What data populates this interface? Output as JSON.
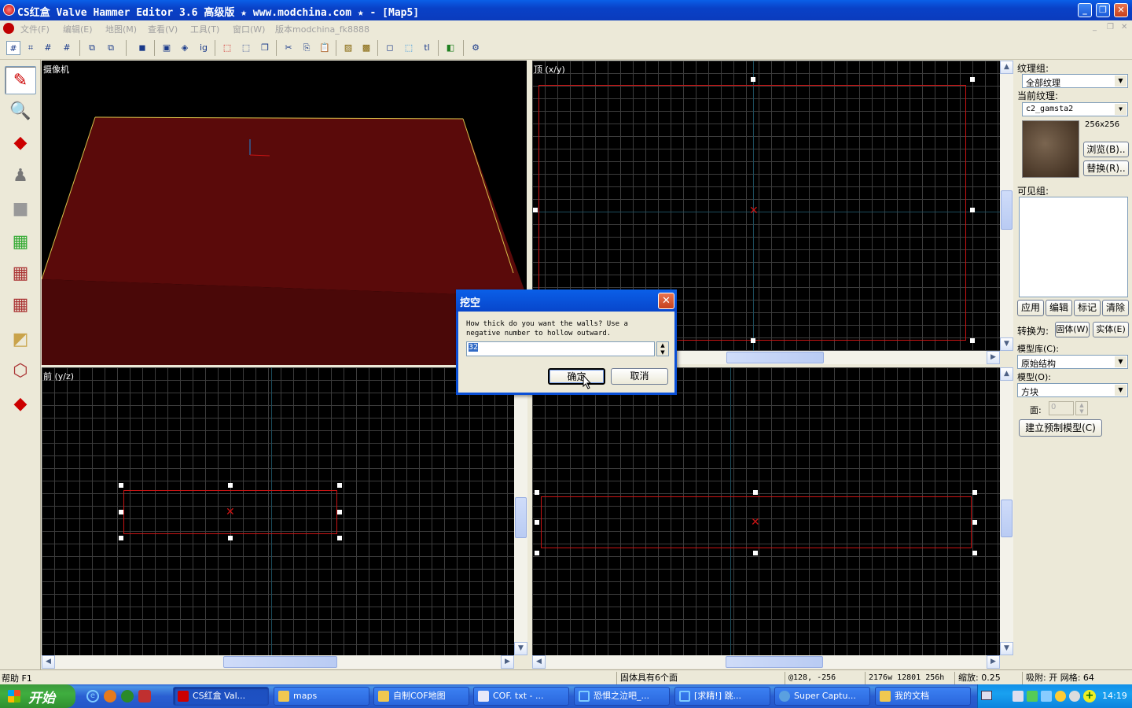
{
  "window": {
    "title": "CS红盒 Valve Hammer Editor 3.6 高级版 ★ www.modchina.com ★ - [Map5]",
    "min": "_",
    "max": "❐",
    "close": "✕"
  },
  "menu": [
    "文件(F)",
    "编辑(E)",
    "地图(M)",
    "查看(V)",
    "工具(T)",
    "窗口(W)",
    "版本modchina_fk8888"
  ],
  "viewports": {
    "camera": "摄像机",
    "top": "顶 (x/y)",
    "front": "前 (y/z)"
  },
  "right_panel": {
    "texture_group_label": "纹理组:",
    "texture_group_value": "全部纹理",
    "current_texture_label": "当前纹理:",
    "current_texture_value": "c2_gamsta2",
    "texture_size": "256x256",
    "browse_button": "浏览(B)..",
    "replace_button": "替换(R)..",
    "visgroup_label": "可见组:",
    "apply_button": "应用",
    "edit_button": "编辑",
    "mark_button": "标记",
    "clear_button": "清除",
    "convert_label": "转换为:",
    "solid_button": "固体(W)",
    "entity_button": "实体(E)",
    "model_lib_label": "模型库(C):",
    "model_lib_value": "原始结构",
    "model_label": "模型(O):",
    "model_value": "方块",
    "faces_label": "面:",
    "faces_value": "0",
    "create_prefab_button": "建立预制模型(C)"
  },
  "dialog": {
    "title": "挖空",
    "message": "How thick do you want the walls? Use a negative number to hollow outward.",
    "input_value": "32",
    "ok_button": "确定",
    "cancel_button": "取消"
  },
  "status": {
    "help": "帮助 F1",
    "selection": "固体具有6个面",
    "coords": "@128, -256",
    "size": "2176w 12801 256h",
    "zoom": "缩放: 0.25",
    "snap": "吸附: 开 网格: 64"
  },
  "taskbar": {
    "start": "开始",
    "tasks": [
      "CS红盒 Val...",
      "maps",
      "自制COF地图",
      "COF. txt - ...",
      "恐惧之泣吧_...",
      "[求精!] 跳...",
      "Super Captu...",
      "我的文档"
    ],
    "clock": "14:19"
  },
  "colors": {
    "selection_red": "#c81414",
    "floor_dark_red": "#5a0a0a",
    "xp_blue": "#0a4fd6"
  }
}
